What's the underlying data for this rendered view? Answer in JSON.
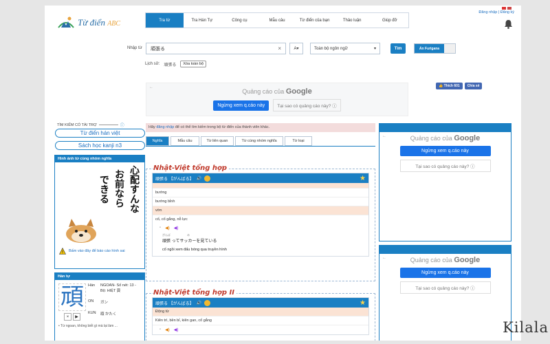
{
  "site": {
    "logo_text": "Từ điển",
    "logo_sub": "ABC"
  },
  "nav": [
    "Tra từ",
    "Tra Hán Tự",
    "Công cụ",
    "Mẫu câu",
    "Từ điển của bạn",
    "Thảo luận",
    "Giúp đỡ"
  ],
  "auth": {
    "login": "Đăng nhập",
    "sep": " | ",
    "register": "Đăng ký"
  },
  "search": {
    "label": "Nhập từ",
    "value": "頑張る",
    "clear": "×",
    "font_size_btn": "A▾",
    "language": "Toàn bộ ngôn ngữ",
    "language_caret": "▾",
    "search_btn": "Tìm",
    "toggle_label": "Ẩn Furigana"
  },
  "history": {
    "label": "Lịch sử:",
    "item": "頑張る",
    "clear": "Xóa toàn bộ"
  },
  "ads": {
    "head": "Quảng cáo của",
    "brand": "Google",
    "stop": "Ngừng xem q.cáo này",
    "why": "Tại sao có quảng cáo này? ⓘ",
    "arrow": "←"
  },
  "facebook": {
    "like": "👍 Thích 601",
    "share": "Chia sẻ"
  },
  "sponsored": {
    "title": "TÌM KIẾM CÓ TÀI TRỢ",
    "info": "ⓘ",
    "links": [
      "Từ điển hán việt",
      "Sách học kanji n3"
    ]
  },
  "image_panel": {
    "title": "Hình ảnh từ cùng nhóm nghĩa",
    "calligraphy": [
      "心配すんな",
      "お前なら",
      "できる"
    ],
    "report": "Bấm vào đây để báo cáo hình sai"
  },
  "hantu": {
    "title": "Hán tự",
    "kanji": "頑",
    "han_label": "Hán",
    "han_value": "NGOAN- Số nét: 13 - Bộ: HIỆT 頁",
    "on_label": "ON",
    "on_value": "ガン",
    "kun_label": "KUN",
    "kun_value": "頑 かたく",
    "btn_close": "×",
    "btn_play": "▶"
  },
  "notice": {
    "prefix": "Hãy ",
    "link": "đăng nhập",
    "suffix": " để có thể tìm kiếm trong bộ từ điển của thành viên khác."
  },
  "tabs": [
    "Nghĩa",
    "Mẫu câu",
    "Từ liên quan",
    "Từ cùng nhóm nghĩa",
    "Từ loại"
  ],
  "dict1": {
    "title": "Nhật-Việt tổng hợp",
    "word": "頑張る 【がんばる】",
    "speaker": "🔊",
    "star": "★",
    "rows": [
      "bướng",
      "bướng bỉnh",
      "vờn",
      "cố, cố gắng, nỗ lực"
    ],
    "sound_bullet": "◦",
    "sound_a": "◀)",
    "sound_b": "◀)",
    "ex_furigana": "がんば　　　　　　み",
    "ex_jp": "頑張 ってサッカーを見ている",
    "ex_vi": "cố ngồi xem đấu bóng qua truyền hình"
  },
  "dict2": {
    "title": "Nhật-Việt tổng hợp II",
    "word": "頑張る 【がんばる】",
    "speaker": "🔊",
    "star": "★",
    "rows": [
      "Động từ",
      "Kiên trì, bền bỉ, kiên gan, cố gắng"
    ],
    "sound_bullet": "◦",
    "sound_a": "◀)",
    "sound_b": "◀)"
  },
  "hantu_more": "• Từ ngoan, không biết gì mà lại làm ...",
  "watermark": "Kilala"
}
